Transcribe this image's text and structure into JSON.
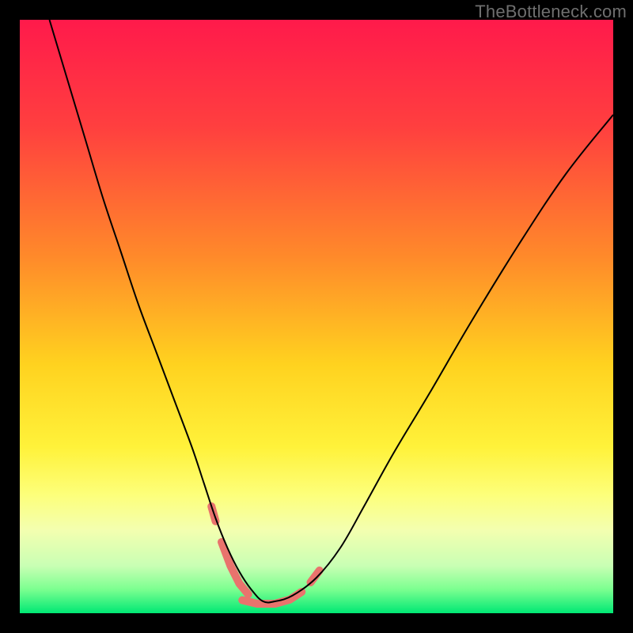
{
  "watermark": "TheBottleneck.com",
  "chart_data": {
    "type": "line",
    "title": "",
    "xlabel": "",
    "ylabel": "",
    "xlim": [
      0,
      100
    ],
    "ylim": [
      0,
      100
    ],
    "grid": false,
    "legend": null,
    "background": {
      "type": "vertical-gradient",
      "stops": [
        {
          "pct": 0,
          "color": "#ff1a4b"
        },
        {
          "pct": 18,
          "color": "#ff3f3f"
        },
        {
          "pct": 40,
          "color": "#ff8a2a"
        },
        {
          "pct": 58,
          "color": "#ffd21f"
        },
        {
          "pct": 72,
          "color": "#fff23a"
        },
        {
          "pct": 80,
          "color": "#fdff7a"
        },
        {
          "pct": 86,
          "color": "#f3ffb0"
        },
        {
          "pct": 92,
          "color": "#c9ffb4"
        },
        {
          "pct": 96,
          "color": "#7bff90"
        },
        {
          "pct": 100,
          "color": "#00e874"
        }
      ]
    },
    "series": [
      {
        "name": "bottleneck-curve",
        "stroke": "#000000",
        "stroke_width": 2,
        "x": [
          5,
          8,
          11,
          14,
          17,
          20,
          23,
          26,
          29,
          31,
          33,
          35,
          37,
          39,
          41,
          43,
          46,
          50,
          54,
          58,
          63,
          69,
          76,
          84,
          92,
          100
        ],
        "values": [
          100,
          90,
          80,
          70,
          61,
          52,
          44,
          36,
          28,
          22,
          16,
          11,
          7,
          4,
          2,
          2,
          3,
          6,
          11,
          18,
          27,
          37,
          49,
          62,
          74,
          84
        ]
      }
    ],
    "highlight_segments": [
      {
        "name": "left-dash",
        "color": "#e9736d",
        "width": 10,
        "points": [
          [
            32.3,
            18
          ],
          [
            33,
            15.5
          ]
        ]
      },
      {
        "name": "descent-run",
        "color": "#e9736d",
        "width": 10,
        "points": [
          [
            34,
            12
          ],
          [
            35.5,
            8
          ],
          [
            37,
            5
          ],
          [
            38.5,
            3.2
          ]
        ]
      },
      {
        "name": "trough-run",
        "color": "#e9736d",
        "width": 10,
        "points": [
          [
            37.5,
            2.2
          ],
          [
            40,
            1.6
          ],
          [
            43,
            1.6
          ],
          [
            45.5,
            2.3
          ],
          [
            47.5,
            3.6
          ]
        ]
      },
      {
        "name": "right-dash",
        "color": "#e9736d",
        "width": 10,
        "points": [
          [
            49,
            5.2
          ],
          [
            50.5,
            7.2
          ]
        ]
      }
    ]
  }
}
